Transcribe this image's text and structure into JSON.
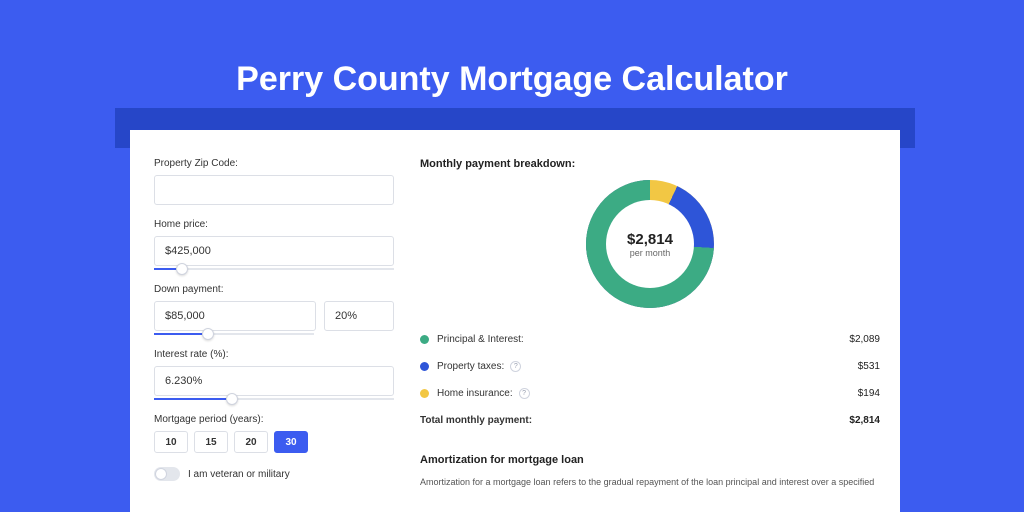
{
  "page": {
    "title": "Perry County Mortgage Calculator"
  },
  "form": {
    "zip_label": "Property Zip Code:",
    "zip_value": "",
    "price_label": "Home price:",
    "price_value": "$425,000",
    "down_label": "Down payment:",
    "down_value": "$85,000",
    "down_pct": "20%",
    "rate_label": "Interest rate (%):",
    "rate_value": "6.230%",
    "period_label": "Mortgage period (years):",
    "periods": [
      "10",
      "15",
      "20",
      "30"
    ],
    "period_active": "30",
    "veteran_label": "I am veteran or military"
  },
  "breakdown": {
    "title": "Monthly payment breakdown:",
    "center_amount": "$2,814",
    "center_sub": "per month",
    "rows": [
      {
        "label": "Principal & Interest:",
        "value": "$2,089",
        "color": "#3cab84",
        "info": false,
        "pct": 74
      },
      {
        "label": "Property taxes:",
        "value": "$531",
        "color": "#2e55d8",
        "info": true,
        "pct": 19
      },
      {
        "label": "Home insurance:",
        "value": "$194",
        "color": "#f2c744",
        "info": true,
        "pct": 7
      }
    ],
    "total_label": "Total monthly payment:",
    "total_value": "$2,814"
  },
  "amort": {
    "title": "Amortization for mortgage loan",
    "text": "Amortization for a mortgage loan refers to the gradual repayment of the loan principal and interest over a specified"
  },
  "chart_data": {
    "type": "pie",
    "title": "Monthly payment breakdown",
    "categories": [
      "Principal & Interest",
      "Property taxes",
      "Home insurance"
    ],
    "values": [
      2089,
      531,
      194
    ],
    "colors": [
      "#3cab84",
      "#2e55d8",
      "#f2c744"
    ],
    "total": 2814,
    "center_label": "$2,814 per month"
  }
}
